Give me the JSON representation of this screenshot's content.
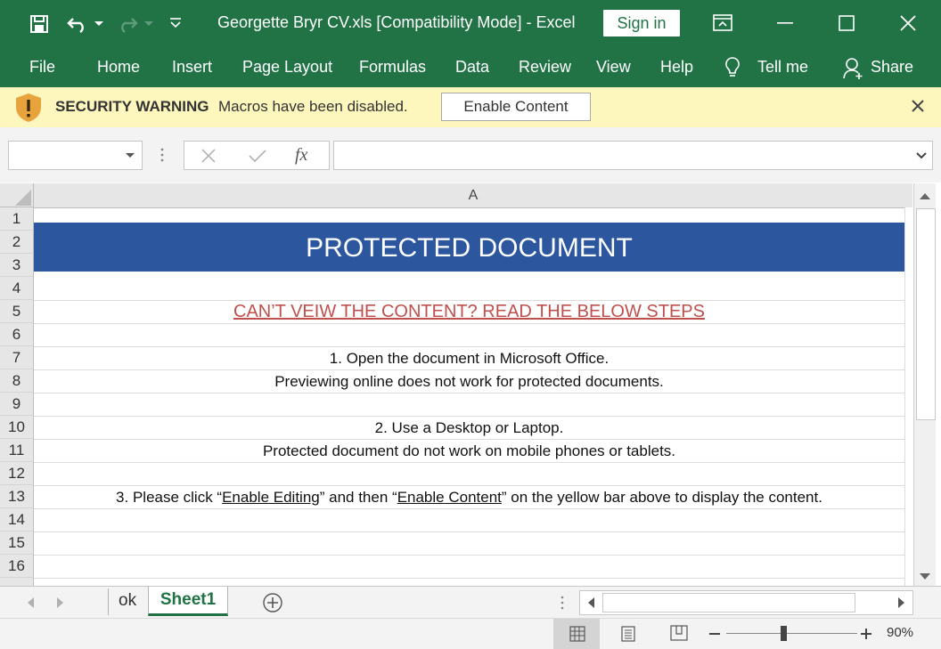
{
  "titlebar": {
    "doc_title": "Georgette Bryr CV.xls  [Compatibility Mode]  -  Excel",
    "sign_in": "Sign in"
  },
  "ribbon_tabs": [
    "File",
    "Home",
    "Insert",
    "Page Layout",
    "Formulas",
    "Data",
    "Review",
    "View",
    "Help",
    "Tell me",
    "Share"
  ],
  "security_bar": {
    "title": "SECURITY WARNING",
    "message": "Macros have been disabled.",
    "button": "Enable Content"
  },
  "formula_bar": {
    "fx": "fx",
    "value": ""
  },
  "grid": {
    "column": "A",
    "rows": [
      "1",
      "2",
      "3",
      "4",
      "5",
      "6",
      "7",
      "8",
      "9",
      "10",
      "11",
      "12",
      "13",
      "14",
      "15",
      "16"
    ],
    "banner": "PROTECTED DOCUMENT",
    "subtitle": "CAN’T VEIW THE CONTENT? READ THE BELOW STEPS",
    "step1a": "1. Open the document in Microsoft Office.",
    "step1b": "Previewing online does not work for protected documents.",
    "step2a": "2. Use a Desktop or Laptop.",
    "step2b": "Protected document do not work on mobile phones or tablets.",
    "step3_pre": "3.  Please click “",
    "step3_link1": "Enable Editing",
    "step3_mid": "” and then “",
    "step3_link2": "Enable Content",
    "step3_post": "” on the yellow bar above to display the content."
  },
  "sheets": {
    "tab1": "ok",
    "tab2": "Sheet1"
  },
  "status": {
    "zoom": "90%"
  },
  "colors": {
    "excel_green": "#217346",
    "banner_blue": "#2c579e",
    "warning_yellow": "#fdf6bd",
    "link_red": "#c0504d"
  }
}
